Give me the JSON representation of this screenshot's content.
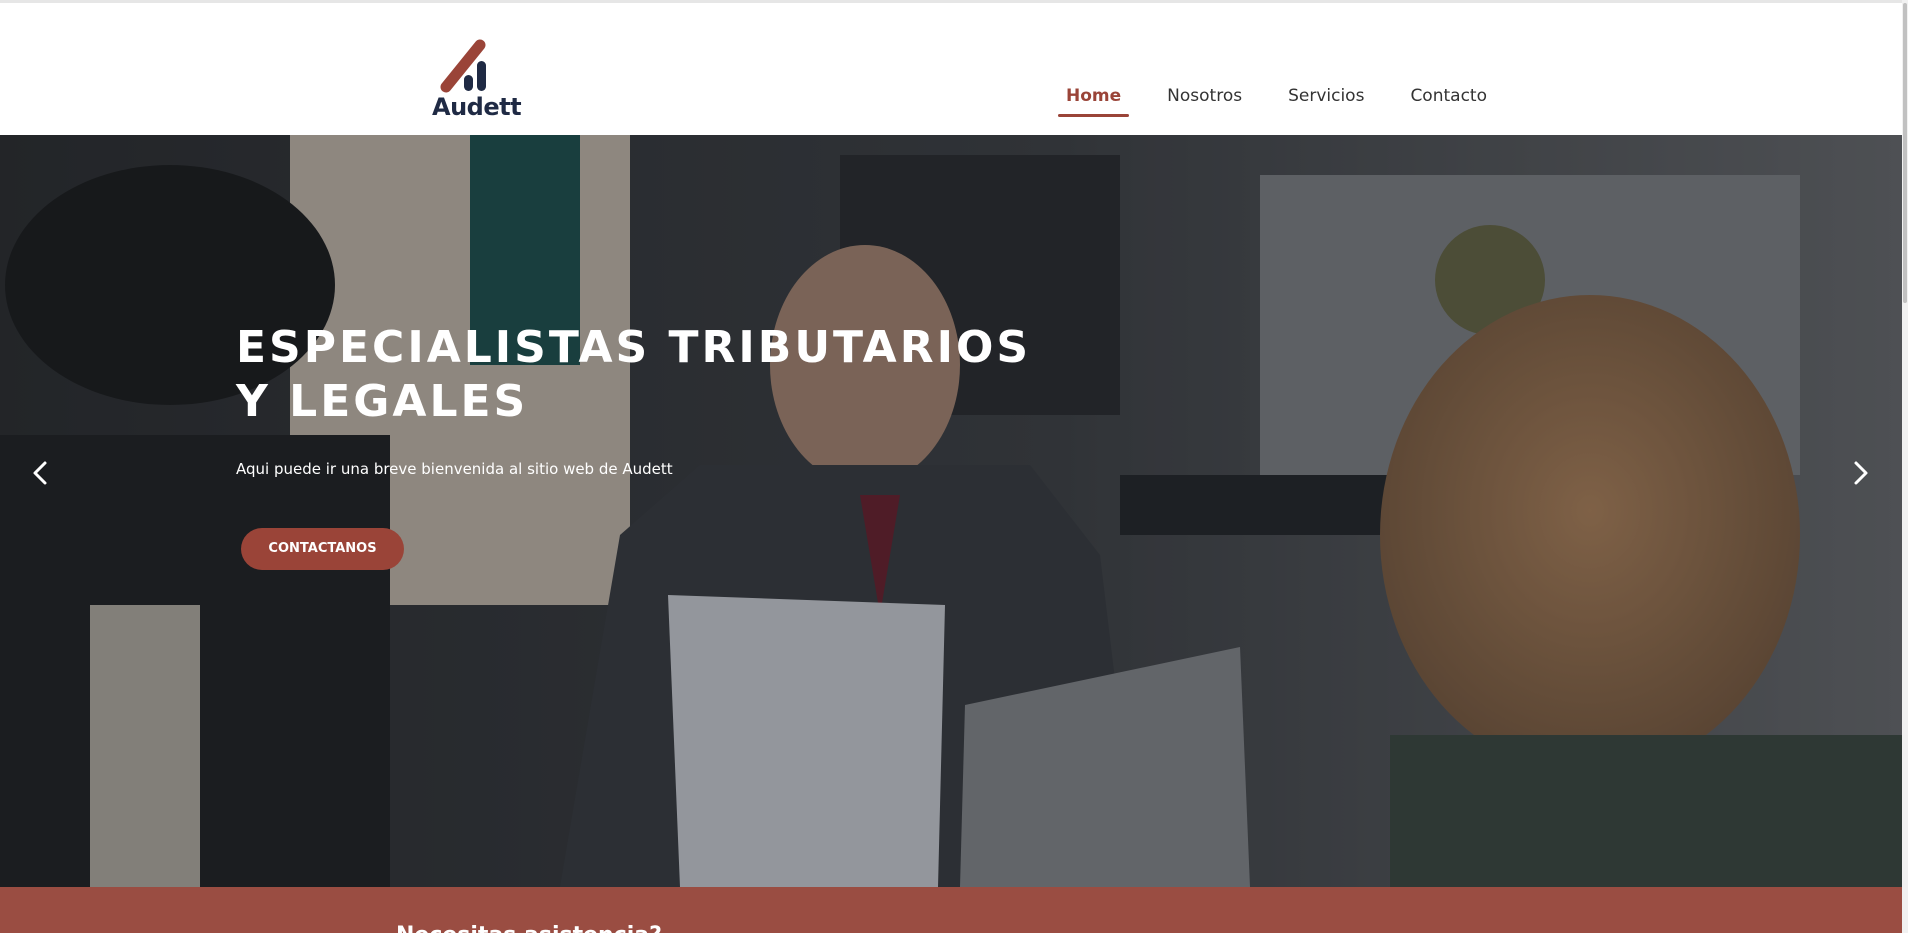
{
  "brand": {
    "name": "Audett",
    "colors": {
      "accent": "#9a4438",
      "logo_dark": "#1f2a44",
      "band": "#9a4d42"
    }
  },
  "nav": {
    "items": [
      {
        "label": "Home",
        "active": true
      },
      {
        "label": "Nosotros",
        "active": false
      },
      {
        "label": "Servicios",
        "active": false
      },
      {
        "label": "Contacto",
        "active": false
      }
    ]
  },
  "hero": {
    "title_line1": "ESPECIALISTAS TRIBUTARIOS",
    "title_line2": "Y LEGALES",
    "subtitle": "Aqui puede ir una breve bienvenida al sitio web de Audett",
    "cta_label": "CONTACTANOS",
    "prev_icon": "chevron-left-icon",
    "next_icon": "chevron-right-icon"
  },
  "band": {
    "heading": "Necesitas asistencia?"
  }
}
